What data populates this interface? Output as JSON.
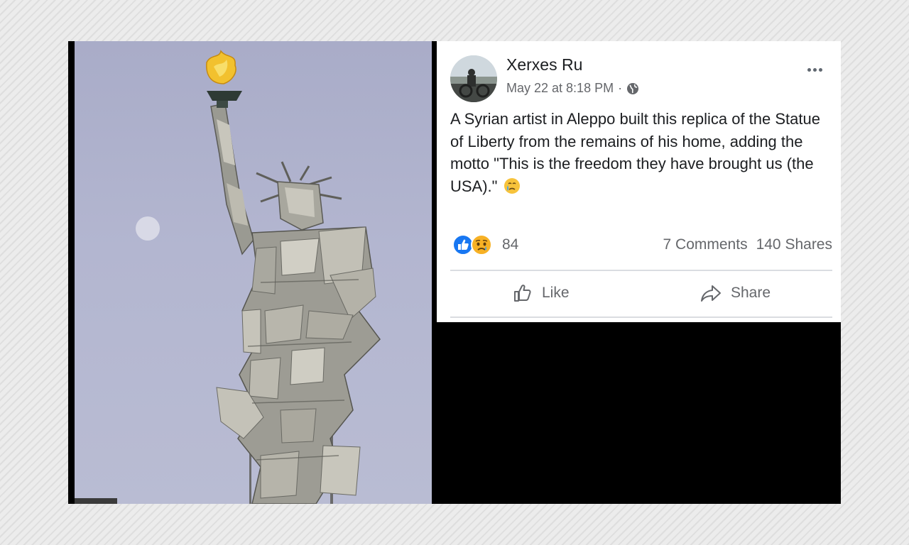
{
  "post": {
    "author": "Xerxes Ru",
    "timestamp": "May 22 at 8:18 PM",
    "separator": "·",
    "audience_icon": "globe-icon",
    "more_icon": "more-options-icon",
    "text": "A Syrian artist in Aleppo built this replica of the Statue of Liberty from the remains of his home, adding the motto \"This is the freedom they have brought us (the USA).\"",
    "text_emoji": "crying-face-emoji",
    "reaction_icons": [
      "like-reaction-icon",
      "sad-reaction-icon"
    ],
    "reaction_count": "84",
    "comments": "7 Comments",
    "shares": "140 Shares",
    "actions": {
      "like_label": "Like",
      "share_label": "Share"
    }
  },
  "photo": {
    "subject": "Statue of Liberty replica made from rubble",
    "sky_color": "#b3b6d0",
    "torch_color": "#f2c12e"
  },
  "colors": {
    "like_blue": "#1877f2",
    "sad_yellow": "#f7b125",
    "text_primary": "#1c1e21",
    "text_secondary": "#65676b"
  }
}
